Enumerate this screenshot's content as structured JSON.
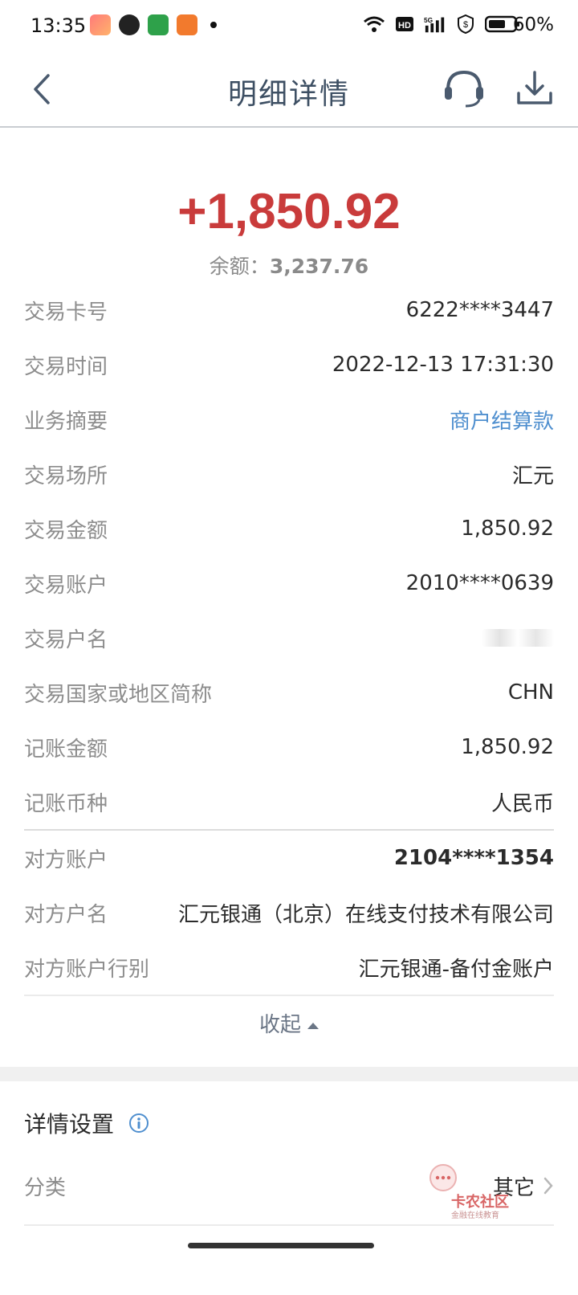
{
  "status_bar": {
    "time": "13:35",
    "battery_percent": "60%",
    "icons": [
      "game-app-icon",
      "video-app-icon",
      "oppo-app-icon",
      "book-app-icon",
      "wifi-icon",
      "hd-icon",
      "signal-5g-icon",
      "shield-icon",
      "battery-icon"
    ]
  },
  "header": {
    "title": "明细详情",
    "back_icon": "chevron-left-icon",
    "service_icon": "headset-icon",
    "download_icon": "download-icon"
  },
  "summary": {
    "amount": "+1,850.92",
    "balance_label": "余额：",
    "balance_value": "3,237.76",
    "amount_color": "#c93b3b"
  },
  "details": [
    {
      "label": "交易卡号",
      "value": "6222****3447"
    },
    {
      "label": "交易时间",
      "value": "2022-12-13 17:31:30"
    },
    {
      "label": "业务摘要",
      "value": "商户结算款"
    },
    {
      "label": "交易场所",
      "value": "汇元"
    },
    {
      "label": "交易金额",
      "value": "1,850.92"
    },
    {
      "label": "交易账户",
      "value": "2010****0639"
    },
    {
      "label": "交易户名",
      "value": ""
    },
    {
      "label": "交易国家或地区简称",
      "value": "CHN"
    },
    {
      "label": "记账金额",
      "value": "1,850.92"
    },
    {
      "label": "记账币种",
      "value": "人民币"
    }
  ],
  "counterparty": [
    {
      "label": "对方账户",
      "value": "2104****1354"
    },
    {
      "label": "对方户名",
      "value": "汇元银通（北京）在线支付技术有限公司"
    },
    {
      "label": "对方账户行别",
      "value": "汇元银通-备付金账户"
    }
  ],
  "collapse_label": "收起",
  "settings": {
    "title": "详情设置",
    "category_label": "分类",
    "category_value": "其它"
  },
  "watermark": {
    "text": "卡农社区",
    "sub": "金融在线教育"
  },
  "link_color": "#4f8fcf"
}
